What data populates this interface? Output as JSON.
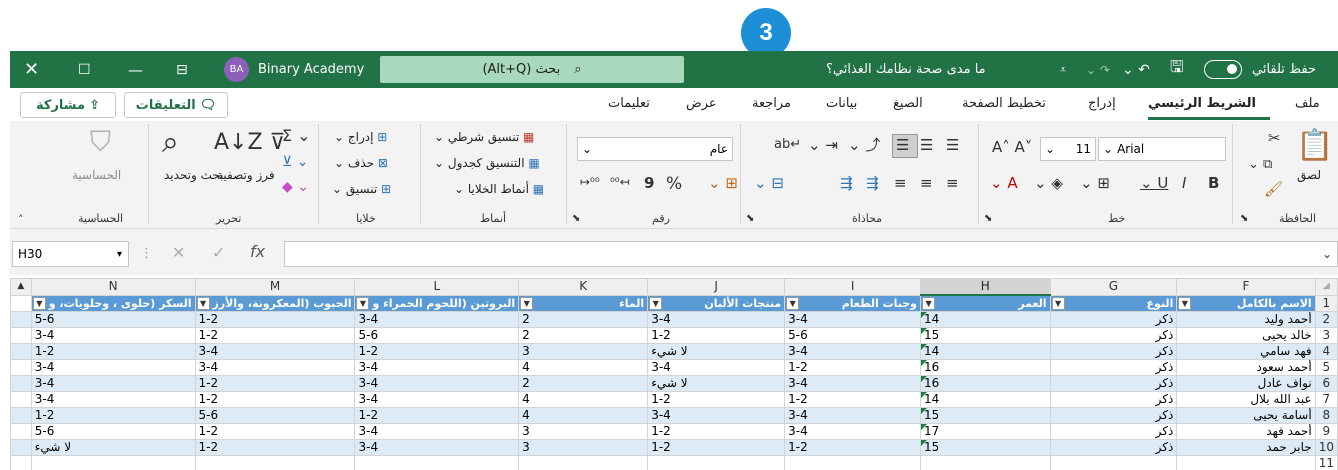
{
  "step_badge": "3",
  "titlebar": {
    "autosave": "حفظ تلقائي",
    "document": "ما مدى صحة نظامك الغذائي؟",
    "search": "بحث (Alt+Q)",
    "user_initials": "BA",
    "user_name": "Binary Academy"
  },
  "ribbon_tabs": [
    "ملف",
    "الشريط الرئيسي",
    "إدراج",
    "تخطيط الصفحة",
    "الصيغ",
    "بيانات",
    "مراجعة",
    "عرض",
    "تعليمات"
  ],
  "ribbon_right": {
    "comments": "التعليقات",
    "share": "مشاركة"
  },
  "ribbon": {
    "clipboard": {
      "paste": "لصق",
      "label": "الحافظة"
    },
    "font": {
      "name": "Arial",
      "size": "11",
      "label": "خط"
    },
    "alignment": {
      "label": "محاذاة"
    },
    "number": {
      "format": "عام",
      "label": "رقم"
    },
    "styles": {
      "conditional": "تنسيق شرطي",
      "as_table": "التنسيق كجدول",
      "cell_styles": "أنماط الخلايا",
      "label": "أنماط"
    },
    "cells": {
      "insert": "إدراج",
      "delete": "حذف",
      "format": "تنسيق",
      "label": "خلايا"
    },
    "editing": {
      "sort": "فرز وتصفية",
      "find": "بحث وتحديد",
      "label": "تحرير"
    },
    "sensitivity": {
      "button": "الحساسية",
      "label": "الحساسية"
    }
  },
  "namebox": "H30",
  "grid": {
    "columns": [
      "F",
      "G",
      "H",
      "I",
      "J",
      "K",
      "L",
      "M",
      "N"
    ],
    "headers": [
      "الاسم بالكامل",
      "النوع",
      "العمر",
      "وجبات الطعام",
      "منتجات الألبان",
      "الماء",
      "البروتين (اللحوم الحمراء و",
      "الحبوب (المعكرونة، والأرز",
      "السكر (حلوى ، وحلويات، و"
    ],
    "rows": [
      {
        "n": "2",
        "cells": [
          "أحمد وليد",
          "ذكر",
          "14",
          "3-4",
          "3-4",
          "2",
          "3-4",
          "1-2",
          "5-6"
        ]
      },
      {
        "n": "3",
        "cells": [
          "خالد يحيى",
          "ذكر",
          "15",
          "5-6",
          "1-2",
          "2",
          "5-6",
          "1-2",
          "3-4"
        ]
      },
      {
        "n": "4",
        "cells": [
          "فهد سامي",
          "ذكر",
          "14",
          "3-4",
          "لا شيء",
          "3",
          "1-2",
          "3-4",
          "1-2"
        ]
      },
      {
        "n": "5",
        "cells": [
          "أحمد سعود",
          "ذكر",
          "16",
          "1-2",
          "3-4",
          "4",
          "3-4",
          "3-4",
          "3-4"
        ]
      },
      {
        "n": "6",
        "cells": [
          "نواف عادل",
          "ذكر",
          "16",
          "3-4",
          "لا شيء",
          "2",
          "3-4",
          "1-2",
          "3-4"
        ]
      },
      {
        "n": "7",
        "cells": [
          "عبد الله بلال",
          "ذكر",
          "14",
          "1-2",
          "1-2",
          "4",
          "3-4",
          "1-2",
          "3-4"
        ]
      },
      {
        "n": "8",
        "cells": [
          "أسامة يحيى",
          "ذكر",
          "15",
          "3-4",
          "3-4",
          "4",
          "1-2",
          "5-6",
          "1-2"
        ]
      },
      {
        "n": "9",
        "cells": [
          "أحمد فهد",
          "ذكر",
          "17",
          "3-4",
          "1-2",
          "3",
          "3-4",
          "1-2",
          "5-6"
        ]
      },
      {
        "n": "10",
        "cells": [
          "جابر حمد",
          "ذكر",
          "15",
          "1-2",
          "1-2",
          "3",
          "3-4",
          "1-2",
          "لا شيء"
        ]
      },
      {
        "n": "11",
        "cells": [
          "",
          "",
          "",
          "",
          "",
          "",
          "",
          "",
          ""
        ]
      }
    ]
  }
}
